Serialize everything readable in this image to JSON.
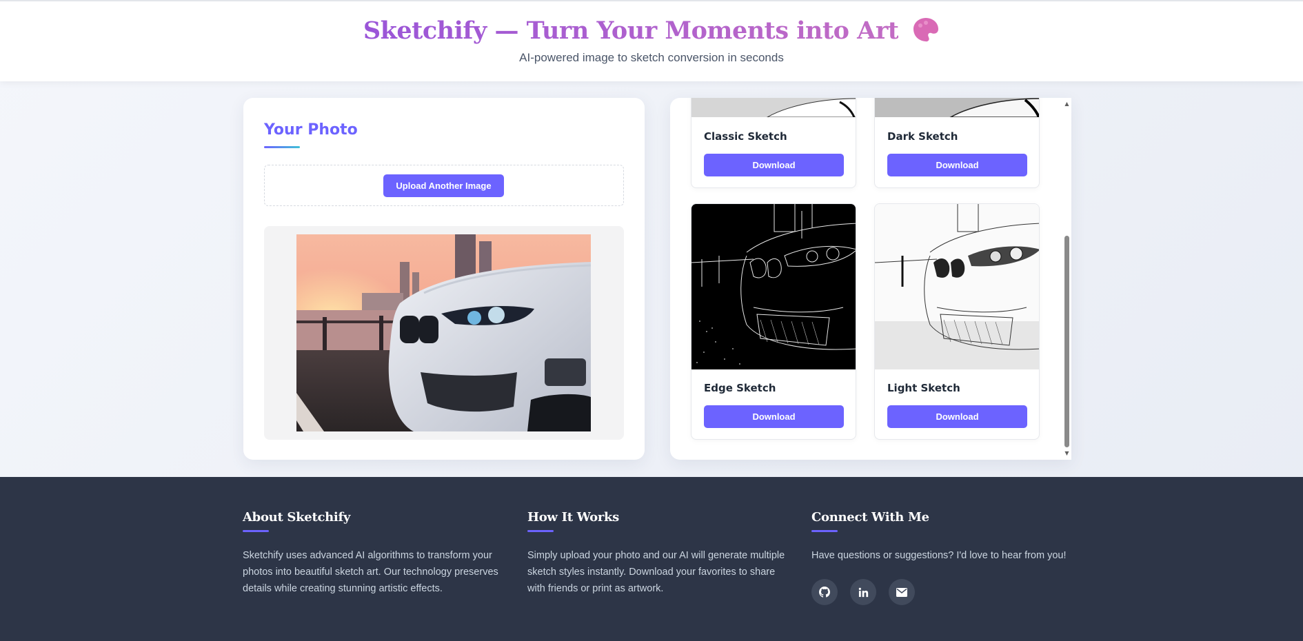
{
  "header": {
    "title": "Sketchify — Turn Your Moments into Art",
    "title_icon": "palette-icon",
    "subtitle": "AI-powered image to sketch conversion in seconds"
  },
  "left_panel": {
    "title": "Your Photo",
    "upload_button": "Upload Another Image",
    "preview_alt": "uploaded car photo"
  },
  "sketches": [
    {
      "label": "Classic Sketch",
      "button": "Download"
    },
    {
      "label": "Dark Sketch",
      "button": "Download"
    },
    {
      "label": "Edge Sketch",
      "button": "Download"
    },
    {
      "label": "Light Sketch",
      "button": "Download"
    }
  ],
  "footer": {
    "about": {
      "heading": "About Sketchify",
      "text": "Sketchify uses advanced AI algorithms to transform your photos into beautiful sketch art. Our technology preserves details while creating stunning artistic effects."
    },
    "how": {
      "heading": "How It Works",
      "text": "Simply upload your photo and our AI will generate multiple sketch styles instantly. Download your favorites to share with friends or print as artwork."
    },
    "connect": {
      "heading": "Connect With Me",
      "text": "Have questions or suggestions? I'd love to hear from you!",
      "social_icons": [
        "github-icon",
        "linkedin-icon",
        "email-icon"
      ]
    }
  },
  "colors": {
    "accent": "#6c63ff",
    "title_gradient_start": "#9a55d8",
    "title_gradient_end": "#c26cc4",
    "footer_bg": "#2d3547"
  }
}
